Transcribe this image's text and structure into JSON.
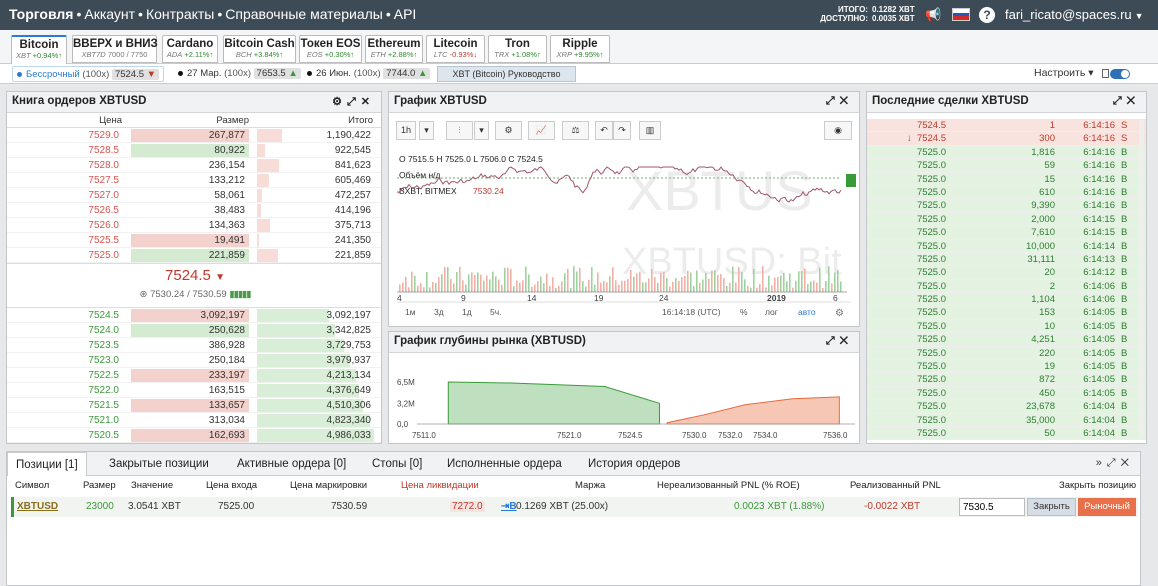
{
  "topbar": {
    "brand": "Торговля",
    "sep": "•",
    "nav": [
      "Аккаунт",
      "Контракты",
      "Справочные материалы",
      "API"
    ],
    "total_label": "ИТОГО:",
    "total_value": "0.1282 XBT",
    "avail_label": "ДОСТУПНО:",
    "avail_value": "0.0035 XBT",
    "user": "fari_ricato@spaces.ru",
    "caret": "▼",
    "help": "?",
    "megaphone": "📢"
  },
  "instruments": [
    {
      "name": "Bitcoin",
      "sym": "XBT",
      "chg": "+0.94%",
      "dir": "pos",
      "left": 11,
      "width": 56,
      "active": true
    },
    {
      "name": "ВВЕРХ и ВНИЗ",
      "sym": "XBT7D",
      "chg": "7000 / 7750",
      "dir": "none",
      "left": 72,
      "width": 85,
      "active": false
    },
    {
      "name": "Cardano",
      "sym": "ADA",
      "chg": "+2.11%",
      "dir": "pos",
      "left": 162,
      "width": 56,
      "active": false
    },
    {
      "name": "Bitcoin Cash",
      "sym": "BCH",
      "chg": "+3.84%",
      "dir": "pos",
      "left": 223,
      "width": 73,
      "active": false
    },
    {
      "name": "Токен EOS",
      "sym": "EOS",
      "chg": "+0.30%",
      "dir": "pos",
      "left": 299,
      "width": 63,
      "active": false
    },
    {
      "name": "Ethereum",
      "sym": "ETH",
      "chg": "+2.88%",
      "dir": "pos",
      "left": 365,
      "width": 58,
      "active": false
    },
    {
      "name": "Litecoin",
      "sym": "LTC",
      "chg": "-0.93%",
      "dir": "neg",
      "left": 426,
      "width": 59,
      "active": false
    },
    {
      "name": "Tron",
      "sym": "TRX",
      "chg": "+1.08%",
      "dir": "pos",
      "left": 488,
      "width": 59,
      "active": false
    },
    {
      "name": "Ripple",
      "sym": "XRP",
      "chg": "+9.95%",
      "dir": "pos",
      "left": 550,
      "width": 60,
      "active": false
    }
  ],
  "contracts": [
    {
      "name": "Бессрочный",
      "lev": "(100x)",
      "price": "7524.5",
      "arrow": "▼",
      "left": 12,
      "active": true
    },
    {
      "name": "27 Мар.",
      "lev": "(100x)",
      "price": "7653.5",
      "arrow": "▲",
      "left": 174,
      "active": false
    },
    {
      "name": "26 Июн.",
      "lev": "(100x)",
      "price": "7744.0",
      "arrow": "▲",
      "left": 303,
      "active": false
    }
  ],
  "guide": "XBT (Bitcoin) Руководство",
  "settings": "Настроить ▾",
  "orderbook": {
    "title": "Книга ордеров XBTUSD",
    "cols": [
      "Цена",
      "Размер",
      "Итого"
    ],
    "asks": [
      {
        "p": "7529.0",
        "s": "267,877",
        "t": "1,190,422",
        "w": 1,
        "hl": "sell"
      },
      {
        "p": "7528.5",
        "s": "80,922",
        "t": "922,545",
        "w": 0.3,
        "hl": "buy"
      },
      {
        "p": "7528.0",
        "s": "236,154",
        "t": "841,623",
        "w": 0.88,
        "hl": ""
      },
      {
        "p": "7527.5",
        "s": "133,212",
        "t": "605,469",
        "w": 0.5,
        "hl": ""
      },
      {
        "p": "7527.0",
        "s": "58,061",
        "t": "472,257",
        "w": 0.22,
        "hl": ""
      },
      {
        "p": "7526.5",
        "s": "38,483",
        "t": "414,196",
        "w": 0.14,
        "hl": ""
      },
      {
        "p": "7526.0",
        "s": "134,363",
        "t": "375,713",
        "w": 0.5,
        "hl": ""
      },
      {
        "p": "7525.5",
        "s": "19,491",
        "t": "241,350",
        "w": 0.07,
        "hl": "sell"
      },
      {
        "p": "7525.0",
        "s": "221,859",
        "t": "221,859",
        "w": 0.83,
        "hl": "buy"
      }
    ],
    "last": "7524.5",
    "last_arrow": "▼",
    "mark": "7530.24 / 7530.59",
    "bids": [
      {
        "p": "7524.5",
        "s": "3,092,197",
        "t": "3,092,197",
        "w": 1,
        "hl": "sell"
      },
      {
        "p": "7524.0",
        "s": "250,628",
        "t": "3,342,825",
        "w": 0.08,
        "hl": "buy"
      },
      {
        "p": "7523.5",
        "s": "386,928",
        "t": "3,729,753",
        "w": 0.13,
        "hl": ""
      },
      {
        "p": "7523.0",
        "s": "250,184",
        "t": "3,979,937",
        "w": 0.08,
        "hl": ""
      },
      {
        "p": "7522.5",
        "s": "233,197",
        "t": "4,213,134",
        "w": 0.08,
        "hl": "sell"
      },
      {
        "p": "7522.0",
        "s": "163,515",
        "t": "4,376,649",
        "w": 0.05,
        "hl": ""
      },
      {
        "p": "7521.5",
        "s": "133,657",
        "t": "4,510,306",
        "w": 0.04,
        "hl": "sell"
      },
      {
        "p": "7521.0",
        "s": "313,034",
        "t": "4,823,340",
        "w": 0.1,
        "hl": ""
      },
      {
        "p": "7520.5",
        "s": "162,693",
        "t": "4,986,033",
        "w": 0.05,
        "hl": "sell"
      }
    ]
  },
  "price_chart": {
    "title": "График XBTUSD",
    "interval": "1h",
    "ohlc": "O 7515.5  H 7525.0  L 7506.0  C 7524.5",
    "vol": "Объём  н/д",
    "src": "BXBT, BITMEX",
    "src_val": "7530.24",
    "watermark1": "XBTUS",
    "watermark2": "XBTUSD: Bit",
    "xticks": [
      "4",
      "9",
      "14",
      "19",
      "24",
      "2019",
      "6"
    ],
    "ranges": [
      "1м",
      "3д",
      "1д",
      "5ч."
    ],
    "time": "16:14:18 (UTC)",
    "opts": [
      "%",
      "лог",
      "авто"
    ]
  },
  "depth_chart": {
    "title": "График глубины рынка (XBTUSD)",
    "yticks": [
      "6,5M",
      "3,2M",
      "0,0"
    ],
    "xticks": [
      "7511.0",
      "7521.0",
      "7524.5",
      "7530.0",
      "7532.0",
      "7534.0",
      "7536.0"
    ]
  },
  "trades": {
    "title": "Последние сделки XBTUSD",
    "rows": [
      {
        "p": "7524.5",
        "s": "1",
        "t": "6:14:16",
        "d": "S",
        "sell": true,
        "arrow": ""
      },
      {
        "p": "7524.5",
        "s": "300",
        "t": "6:14:16",
        "d": "S",
        "sell": true,
        "arrow": "↓"
      },
      {
        "p": "7525.0",
        "s": "1,816",
        "t": "6:14:16",
        "d": "B",
        "sell": false,
        "arrow": ""
      },
      {
        "p": "7525.0",
        "s": "59",
        "t": "6:14:16",
        "d": "B",
        "sell": false,
        "arrow": ""
      },
      {
        "p": "7525.0",
        "s": "15",
        "t": "6:14:16",
        "d": "B",
        "sell": false,
        "arrow": ""
      },
      {
        "p": "7525.0",
        "s": "610",
        "t": "6:14:16",
        "d": "B",
        "sell": false,
        "arrow": ""
      },
      {
        "p": "7525.0",
        "s": "9,390",
        "t": "6:14:16",
        "d": "B",
        "sell": false,
        "arrow": ""
      },
      {
        "p": "7525.0",
        "s": "2,000",
        "t": "6:14:15",
        "d": "B",
        "sell": false,
        "arrow": ""
      },
      {
        "p": "7525.0",
        "s": "7,610",
        "t": "6:14:15",
        "d": "B",
        "sell": false,
        "arrow": ""
      },
      {
        "p": "7525.0",
        "s": "10,000",
        "t": "6:14:14",
        "d": "B",
        "sell": false,
        "arrow": ""
      },
      {
        "p": "7525.0",
        "s": "31,111",
        "t": "6:14:13",
        "d": "B",
        "sell": false,
        "arrow": ""
      },
      {
        "p": "7525.0",
        "s": "20",
        "t": "6:14:12",
        "d": "B",
        "sell": false,
        "arrow": ""
      },
      {
        "p": "7525.0",
        "s": "2",
        "t": "6:14:06",
        "d": "B",
        "sell": false,
        "arrow": ""
      },
      {
        "p": "7525.0",
        "s": "1,104",
        "t": "6:14:06",
        "d": "B",
        "sell": false,
        "arrow": ""
      },
      {
        "p": "7525.0",
        "s": "153",
        "t": "6:14:05",
        "d": "B",
        "sell": false,
        "arrow": ""
      },
      {
        "p": "7525.0",
        "s": "10",
        "t": "6:14:05",
        "d": "B",
        "sell": false,
        "arrow": ""
      },
      {
        "p": "7525.0",
        "s": "4,251",
        "t": "6:14:05",
        "d": "B",
        "sell": false,
        "arrow": ""
      },
      {
        "p": "7525.0",
        "s": "220",
        "t": "6:14:05",
        "d": "B",
        "sell": false,
        "arrow": ""
      },
      {
        "p": "7525.0",
        "s": "19",
        "t": "6:14:05",
        "d": "B",
        "sell": false,
        "arrow": ""
      },
      {
        "p": "7525.0",
        "s": "872",
        "t": "6:14:05",
        "d": "B",
        "sell": false,
        "arrow": ""
      },
      {
        "p": "7525.0",
        "s": "450",
        "t": "6:14:05",
        "d": "B",
        "sell": false,
        "arrow": ""
      },
      {
        "p": "7525.0",
        "s": "23,678",
        "t": "6:14:04",
        "d": "B",
        "sell": false,
        "arrow": ""
      },
      {
        "p": "7525.0",
        "s": "35,000",
        "t": "6:14:04",
        "d": "B",
        "sell": false,
        "arrow": ""
      },
      {
        "p": "7525.0",
        "s": "50",
        "t": "6:14:04",
        "d": "B",
        "sell": false,
        "arrow": ""
      }
    ]
  },
  "bottom": {
    "tabs": [
      "Позиции [1]",
      "Закрытые позиции",
      "Активные ордера [0]",
      "Стопы [0]",
      "Исполненные ордера",
      "История ордеров"
    ],
    "cols": [
      "Символ",
      "Размер",
      "Значение",
      "Цена входа",
      "Цена маркировки",
      "Цена ликвидации",
      "Маржа",
      "Нереализованный PNL (% ROE)",
      "Реализованный PNL",
      "Закрыть позицию"
    ],
    "row": {
      "sym": "XBTUSD",
      "size": "23000",
      "value": "3.0541 XBT",
      "entry": "7525.00",
      "mark": "7530.59",
      "liq": "7272.0",
      "margin_icon": "⇥B",
      "margin": "0.1269 XBT (25.00x)",
      "upnl": "0.0023 XBT (1.88%)",
      "rpnl": "-0.0022 XBT",
      "close_price": "7530.5",
      "close_btn": "Закрыть",
      "market_btn": "Рыночный"
    }
  },
  "chart_data": [
    {
      "type": "line",
      "x": [
        "4",
        "9",
        "14",
        "19",
        "24",
        "2019",
        "6"
      ],
      "ohlc": "O 7515.5  H 7525.0  L 7506.0  C 7524.5",
      "last": 7524.5
    },
    {
      "type": "area",
      "series": [
        {
          "name": "bids",
          "x": [
            7511.0,
            7521.0,
            7524.5
          ],
          "values": [
            6.5,
            5.8,
            3.2
          ]
        },
        {
          "name": "asks",
          "x": [
            7525.0,
            7530.0,
            7536.0
          ],
          "values": [
            0.2,
            3.0,
            4.2
          ]
        }
      ],
      "xticks": [
        "7511.0",
        "7521.0",
        "7524.5",
        "7530.0",
        "7532.0",
        "7534.0",
        "7536.0"
      ],
      "yticks": [
        "6,5M",
        "3,2M",
        "0,0"
      ]
    }
  ],
  "colors": {
    "topbar": "#3d4b57",
    "sell": "#d9534f",
    "buy": "#3a9a3a",
    "accent": "#2b7bd6"
  }
}
